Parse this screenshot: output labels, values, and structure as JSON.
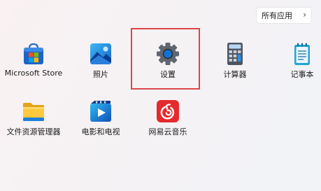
{
  "header": {
    "all_apps_label": "所有应用",
    "chevron": "›"
  },
  "apps": [
    {
      "label": "Microsoft Store",
      "icon": "store-icon"
    },
    {
      "label": "照片",
      "icon": "photos-icon"
    },
    {
      "label": "设置",
      "icon": "settings-gear-icon",
      "highlighted": true
    },
    {
      "label": "计算器",
      "icon": "calculator-icon"
    },
    {
      "label": "记事本",
      "icon": "notepad-icon"
    },
    {
      "label": "文件资源管理器",
      "icon": "folder-icon"
    },
    {
      "label": "电影和电视",
      "icon": "movies-tv-icon"
    },
    {
      "label": "网易云音乐",
      "icon": "netease-music-icon"
    }
  ],
  "colors": {
    "highlight_border": "#d9464a",
    "netease_red": "#e42a2e",
    "settings_blue": "#1470d2"
  }
}
